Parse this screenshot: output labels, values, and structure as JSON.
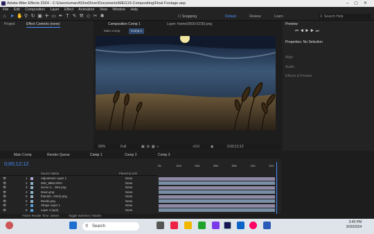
{
  "titlebar": {
    "title": "Adobe After Effects 2024 - C:\\Users\\umarsf\\OneDrive\\Documents\\MEG16-Compositing\\Final Footage.aep"
  },
  "menu": [
    "File",
    "Edit",
    "Composition",
    "Layer",
    "Effect",
    "Animation",
    "View",
    "Window",
    "Help"
  ],
  "toolbar": {
    "snapping_label": "Snapping",
    "workspaces": [
      "Default",
      "Review",
      "Learn"
    ],
    "search_placeholder": "Search Help"
  },
  "left_panel": {
    "tabs": [
      "Project",
      "Effect Controls (none)"
    ]
  },
  "composition": {
    "tab": "Composition Comp 1",
    "layer_tab": "Layer: frame(0000-0230).png",
    "subtabs": [
      "Main Comp",
      "Comp 1"
    ],
    "zoom": "50%",
    "resolution": "Full",
    "exposure": "+0.0",
    "timecode": "0;00;12;12"
  },
  "right_panel": {
    "preview_title": "Preview",
    "properties_title": "Properties: No Selection",
    "sections": [
      "Align",
      "Audio",
      "Effects & Presets"
    ]
  },
  "timeline": {
    "tabs": [
      "Main Comp",
      "Render Queue",
      "Comp 1",
      "Comp 2",
      "Comp 3"
    ],
    "timecode": "0;00;12;12",
    "columns": {
      "source_name": "Source Name",
      "parent": "Parent & Link"
    },
    "ruler_ticks": [
      "0s",
      "02s",
      "04s",
      "06s",
      "08s",
      "10s",
      "12s"
    ],
    "layers": [
      {
        "num": "1",
        "name": "Adjustment Layer 1",
        "parent": "None",
        "color": "#b0a7d6"
      },
      {
        "num": "2",
        "name": "IMG_9882.MOV",
        "parent": "None",
        "color": "#8fb3c9"
      },
      {
        "num": "3",
        "name": "scene 2... intro.png",
        "parent": "None",
        "color": "#8fb3c9"
      },
      {
        "num": "4",
        "name": "Moon.png",
        "parent": "None",
        "color": "#8fb3c9"
      },
      {
        "num": "5",
        "name": "frame(0...0312).png",
        "parent": "None",
        "color": "#8fb3c9"
      },
      {
        "num": "6",
        "name": "Reeds.png",
        "parent": "None",
        "color": "#8fb3c9"
      },
      {
        "num": "7",
        "name": "Shape Layer 1",
        "parent": "None",
        "color": "#5aa0d8"
      },
      {
        "num": "8",
        "name": "Layer 2 (eps)",
        "parent": "None",
        "color": "#5aa0d8"
      }
    ],
    "footer": "Frame Render Time: 226ms",
    "footer_toggle": "Toggle Switches / Modes"
  },
  "taskbar": {
    "search_placeholder": "Search",
    "time": "3:45 PM",
    "date": "9/30/2024"
  }
}
